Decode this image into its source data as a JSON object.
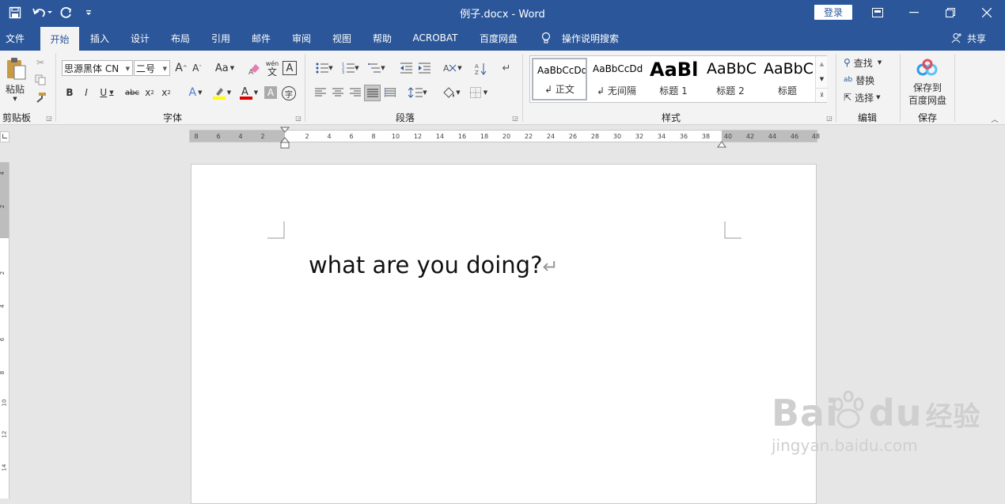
{
  "window": {
    "title": "例子.docx  -  Word",
    "login": "登录"
  },
  "tabs": [
    {
      "label": "文件"
    },
    {
      "label": "开始"
    },
    {
      "label": "插入"
    },
    {
      "label": "设计"
    },
    {
      "label": "布局"
    },
    {
      "label": "引用"
    },
    {
      "label": "邮件"
    },
    {
      "label": "审阅"
    },
    {
      "label": "视图"
    },
    {
      "label": "帮助"
    },
    {
      "label": "ACROBAT"
    },
    {
      "label": "百度网盘"
    }
  ],
  "search": {
    "label": "操作说明搜索"
  },
  "share": {
    "label": "共享"
  },
  "ribbon": {
    "clipboard": {
      "paste": "粘贴",
      "group": "剪贴板"
    },
    "font": {
      "family": "思源黑体 CN",
      "size": "二号",
      "group": "字体",
      "case": "Aa",
      "wen": "wén",
      "wen_char": "文",
      "A": "A"
    },
    "paragraph": {
      "group": "段落"
    },
    "styles": {
      "group": "样式",
      "items": [
        {
          "preview": "AaBbCcDd",
          "name": "正文"
        },
        {
          "preview": "AaBbCcDd",
          "name": "无间隔"
        },
        {
          "preview": "AaBl",
          "name": "标题 1"
        },
        {
          "preview": "AaBbC",
          "name": "标题 2"
        },
        {
          "preview": "AaBbC",
          "name": "标题"
        }
      ]
    },
    "editing": {
      "find": "查找",
      "replace": "替换",
      "select": "选择",
      "group": "编辑"
    },
    "save": {
      "line1": "保存到",
      "line2": "百度网盘",
      "group": "保存"
    }
  },
  "ruler": {
    "left": [
      "8",
      "6",
      "4",
      "2"
    ],
    "right": [
      "2",
      "4",
      "6",
      "8",
      "10",
      "12",
      "14",
      "16",
      "18",
      "20",
      "22",
      "24",
      "26",
      "28",
      "30",
      "32",
      "34",
      "36",
      "38",
      "40",
      "42",
      "44",
      "46",
      "48"
    ],
    "vertical": [
      "4",
      "2",
      "2",
      "4",
      "6",
      "8",
      "10",
      "12",
      "14"
    ]
  },
  "document": {
    "text": "what are you doing?"
  },
  "watermark": {
    "brand": "Bai",
    "brand2": "du",
    "cn": "经验",
    "url": "jingyan.baidu.com"
  },
  "colors": {
    "accent": "#2b579a",
    "ribbon": "#f3f3f3",
    "highlight": "#ffff00",
    "font_red": "#e00000"
  }
}
